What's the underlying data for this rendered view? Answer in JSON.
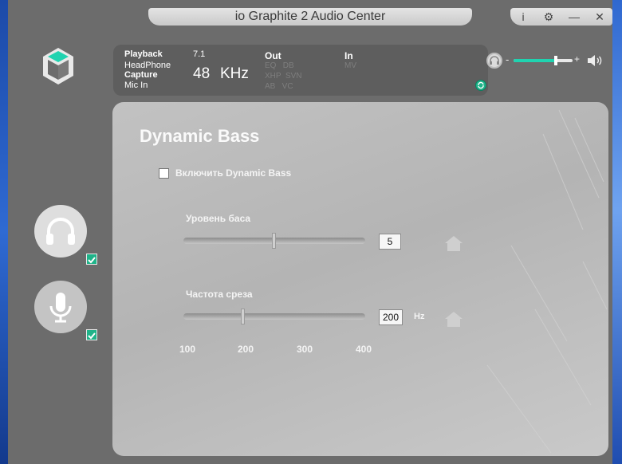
{
  "window": {
    "title": "io Graphite 2 Audio Center",
    "controls": [
      {
        "name": "info-icon",
        "glyph": "i"
      },
      {
        "name": "gear-icon",
        "glyph": "⚙"
      },
      {
        "name": "minimize-icon",
        "glyph": "—"
      },
      {
        "name": "close-icon",
        "glyph": "✕"
      }
    ]
  },
  "status": {
    "playback_label": "Playback",
    "playback_device": "HeadPhone",
    "capture_label": "Capture",
    "capture_device": "Mic In",
    "channels": "7.1",
    "sample_rate_value": "48",
    "sample_rate_unit": "KHz",
    "out_label": "Out",
    "out_features_1": "EQ   DB",
    "out_features_2": "XHP  SVN",
    "out_features_3": "AB   VC",
    "in_label": "In",
    "in_features_1": "MV"
  },
  "volume": {
    "minus": "-",
    "plus": "+",
    "level": 0.72,
    "accent": "#1fd3b0"
  },
  "panel": {
    "title": "Dynamic Bass",
    "enable_label": "Включить Dynamic Bass",
    "enabled": false,
    "bass_level": {
      "label": "Уровень баса",
      "value": "5",
      "min": 0,
      "max": 10,
      "position": 0.5
    },
    "cutoff": {
      "label": "Частота среза",
      "value": "200",
      "unit": "Hz",
      "ticks": [
        "100",
        "200",
        "300",
        "400"
      ],
      "position": 0.33
    }
  },
  "sidebar": {
    "headphone_selected": true,
    "mic_selected": true
  }
}
